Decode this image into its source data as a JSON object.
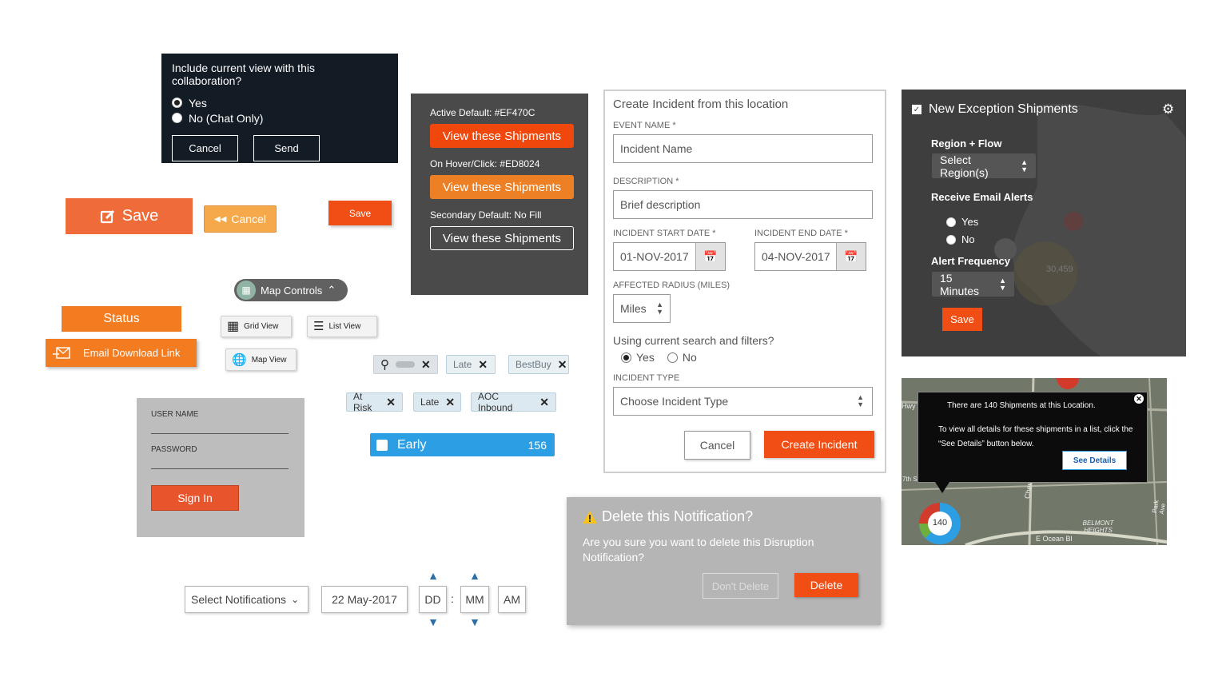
{
  "collab": {
    "question": "Include current view with this collaboration?",
    "options": [
      "Yes",
      "No (Chat Only)"
    ],
    "selected": "Yes",
    "cancel": "Cancel",
    "send": "Send"
  },
  "shipments_panel": {
    "active_label": "Active Default: #EF470C",
    "hover_label": "On Hover/Click: #ED8024",
    "secondary_label": "Secondary Default: No Fill",
    "button_label": "View these Shipments",
    "colors": {
      "active": "#EF470C",
      "hover": "#ED8024"
    }
  },
  "buttons": {
    "save_big": "Save",
    "cancel": "Cancel",
    "save_small": "Save",
    "map_controls": "Map Controls",
    "status": "Status",
    "email_download": "Email Download Link",
    "grid_view": "Grid View",
    "list_view": "List View",
    "map_view": "Map View"
  },
  "chips": {
    "row1": [
      "Late",
      "BestBuy"
    ],
    "row2": [
      "At Risk",
      "Late",
      "AOC Inbound"
    ]
  },
  "early": {
    "label": "Early",
    "count": "156"
  },
  "login": {
    "username_label": "USER NAME",
    "password_label": "PASSWORD",
    "signin": "Sign In"
  },
  "bottom_controls": {
    "select_notifications": "Select Notifications",
    "date": "22 May-2017",
    "dd": "DD",
    "mm": "MM",
    "ampm": "AM",
    "sep": ":"
  },
  "incident": {
    "title": "Create Incident from this location",
    "event_name_label": "EVENT NAME *",
    "event_name_placeholder": "Incident Name",
    "description_label": "DESCRIPTION *",
    "description_placeholder": "Brief description",
    "start_label": "INCIDENT START DATE *",
    "start_value": "01-NOV-2017",
    "end_label": "INCIDENT END DATE *",
    "end_value": "04-NOV-2017",
    "radius_label": "AFFECTED RADIUS (MILES)",
    "radius_value": "Miles",
    "filters_question": "Using current search and filters?",
    "filters_yes": "Yes",
    "filters_no": "No",
    "type_label": "INCIDENT TYPE",
    "type_placeholder": "Choose Incident Type",
    "cancel": "Cancel",
    "create": "Create Incident"
  },
  "delete_dialog": {
    "title": "Delete this Notification?",
    "body": "Are you sure you want to delete this Disruption Notification?",
    "dont_delete": "Don't Delete",
    "delete": "Delete"
  },
  "exception_panel": {
    "title": "New Exception Shipments",
    "region_label": "Region + Flow",
    "region_select": "Select Region(s)",
    "email_label": "Receive Email Alerts",
    "email_yes": "Yes",
    "email_no": "No",
    "freq_label": "Alert Frequency",
    "freq_value": "15 Minutes",
    "save": "Save",
    "map_count": "30,459"
  },
  "map_tooltip": {
    "line1": "There are 140 Shipments at this Location.",
    "line2": "To view all details for these shipments in a list, click the “See Details” button below.",
    "see_details": "See Details",
    "cluster_count": "140",
    "labels": [
      "Cherry Ave",
      "BELMONT HEIGHTS",
      "E Ocean Bl",
      "Park Ave",
      "7th St",
      "Hwy"
    ]
  }
}
